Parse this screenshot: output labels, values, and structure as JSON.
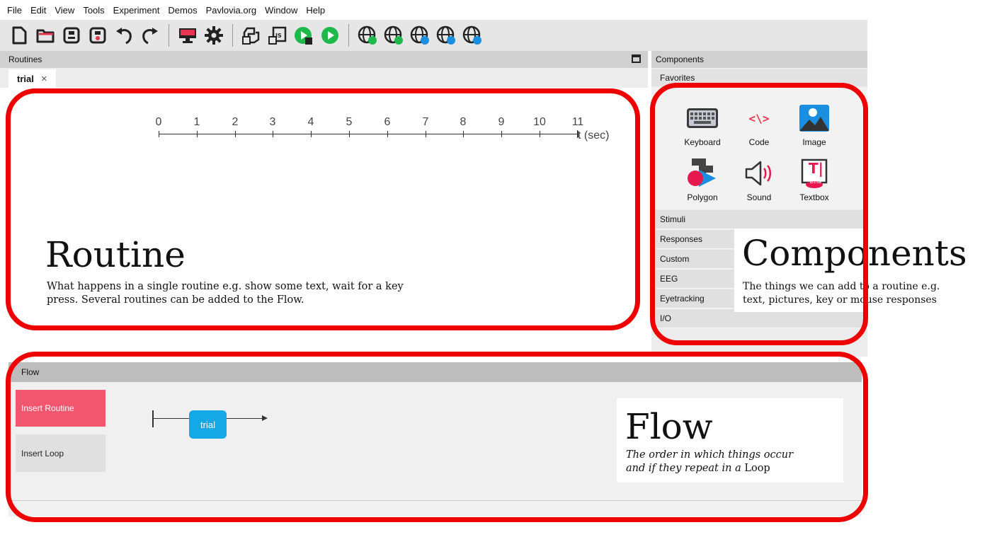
{
  "menu": [
    "File",
    "Edit",
    "View",
    "Tools",
    "Experiment",
    "Demos",
    "Pavlovia.org",
    "Window",
    "Help"
  ],
  "toolbar": {
    "icons": [
      "new-file-icon",
      "open-folder-icon",
      "save-icon",
      "save-as-icon",
      "undo-icon",
      "redo-icon",
      "monitor-icon",
      "gear-icon",
      "python-icon",
      "js-icon",
      "build-run-icon",
      "run-icon",
      "globe-run-icon",
      "globe-sync-icon",
      "globe-search-icon",
      "globe-user-icon",
      "globe-info-icon"
    ],
    "js_label": "JS"
  },
  "routines": {
    "title": "Routines",
    "tab": "trial",
    "tab_close": "×",
    "timeline": {
      "ticks": [
        "0",
        "1",
        "2",
        "3",
        "4",
        "5",
        "6",
        "7",
        "8",
        "9",
        "10",
        "11"
      ],
      "unit": "t (sec)"
    }
  },
  "components": {
    "title": "Components",
    "favorites_label": "Favorites",
    "favorites": [
      {
        "label": "Keyboard",
        "icon": "keyboard-icon"
      },
      {
        "label": "Code",
        "icon": "code-icon",
        "glyph": "<\\>"
      },
      {
        "label": "Image",
        "icon": "image-icon"
      },
      {
        "label": "Polygon",
        "icon": "polygon-icon"
      },
      {
        "label": "Sound",
        "icon": "sound-icon"
      },
      {
        "label": "Textbox",
        "icon": "textbox-icon",
        "glyph": "T|",
        "badge": "Beta"
      }
    ],
    "categories": [
      "Stimuli",
      "Responses",
      "Custom",
      "EEG",
      "Eyetracking",
      "I/O"
    ]
  },
  "flow": {
    "title": "Flow",
    "insert_routine": "Insert Routine",
    "insert_loop": "Insert Loop",
    "routine_name": "trial"
  },
  "annotations": {
    "routine": {
      "title": "Routine",
      "text_line1": "What happens in a single routine e.g. show some text, wait for a key",
      "text_line2": "press. Several routines can be added to the Flow."
    },
    "components": {
      "title": "Components",
      "text_line1": "The things we can add to a routine e.g.",
      "text_line2": "text, pictures, key or mouse responses"
    },
    "flow": {
      "title": "Flow",
      "text_line1": "The order in which things occur",
      "text_line2_italic": "and if they repeat in a",
      "text_line2_plain": "Loop"
    }
  },
  "colors": {
    "annotation_ring": "#ee0000",
    "insert_routine": "#f2556e",
    "flow_routine": "#14a8e6",
    "run_green": "#1fb84b"
  }
}
